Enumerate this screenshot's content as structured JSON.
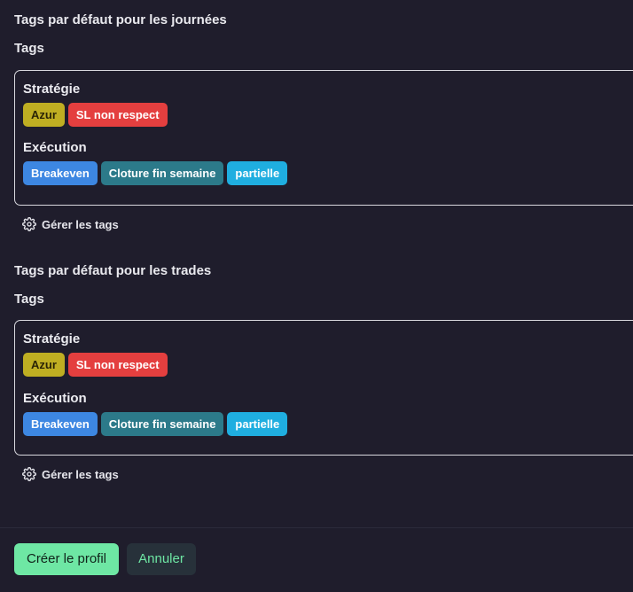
{
  "sections": [
    {
      "title": "Tags par défaut pour les journées",
      "tags_label": "Tags",
      "groups": [
        {
          "name": "Stratégie",
          "tags": [
            {
              "label": "Azur",
              "bg": "#bfae22",
              "fg": "#2a2406"
            },
            {
              "label": "SL non respect",
              "bg": "#e43f3f",
              "fg": "#ffffff"
            }
          ]
        },
        {
          "name": "Exécution",
          "tags": [
            {
              "label": "Breakeven",
              "bg": "#3d87e2",
              "fg": "#ffffff"
            },
            {
              "label": "Cloture fin semaine",
              "bg": "#2c7a8a",
              "fg": "#ffffff"
            },
            {
              "label": "partielle",
              "bg": "#1faee0",
              "fg": "#ffffff"
            }
          ]
        }
      ],
      "manage_label": "Gérer les tags"
    },
    {
      "title": "Tags par défaut pour les trades",
      "tags_label": "Tags",
      "groups": [
        {
          "name": "Stratégie",
          "tags": [
            {
              "label": "Azur",
              "bg": "#bfae22",
              "fg": "#2a2406"
            },
            {
              "label": "SL non respect",
              "bg": "#e43f3f",
              "fg": "#ffffff"
            }
          ]
        },
        {
          "name": "Exécution",
          "tags": [
            {
              "label": "Breakeven",
              "bg": "#3d87e2",
              "fg": "#ffffff"
            },
            {
              "label": "Cloture fin semaine",
              "bg": "#2c7a8a",
              "fg": "#ffffff"
            },
            {
              "label": "partielle",
              "bg": "#1faee0",
              "fg": "#ffffff"
            }
          ]
        }
      ],
      "manage_label": "Gérer les tags"
    }
  ],
  "footer": {
    "create_label": "Créer le profil",
    "cancel_label": "Annuler"
  },
  "icons": {
    "manage": "gear-icon"
  }
}
